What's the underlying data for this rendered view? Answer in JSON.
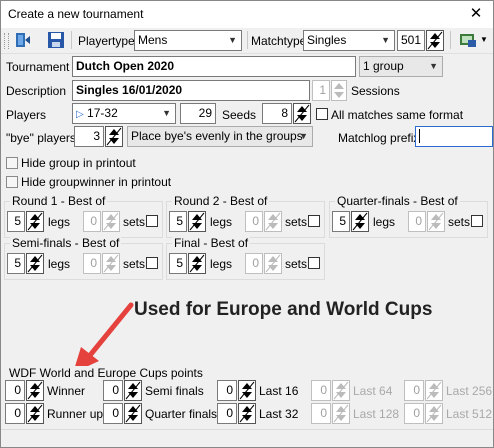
{
  "window": {
    "title": "Create a new tournament",
    "close_glyph": "✕"
  },
  "toolbar": {
    "playertype_label": "Playertype",
    "playertype_value": "Mens",
    "matchtype_label": "Matchtype",
    "matchtype_value": "Singles",
    "score_value": "501"
  },
  "form": {
    "tournament_label": "Tournament",
    "tournament_value": "Dutch Open 2020",
    "groups_value": "1 group",
    "description_label": "Description",
    "description_value": "Singles 16/01/2020",
    "sessions_value": "1",
    "sessions_label": "Sessions",
    "players_label": "Players",
    "players_range_value": "17-32",
    "players_count": "29",
    "seeds_label": "Seeds",
    "seeds_value": "8",
    "same_format_label": "All matches same format",
    "bye_label": "\"bye\" players",
    "bye_value": "3",
    "bye_mode_value": "Place bye's evenly in the groups",
    "matchlog_label": "Matchlog prefix",
    "matchlog_value": "",
    "hide_group_label": "Hide group in printout",
    "hide_groupwinner_label": "Hide groupwinner in printout"
  },
  "rounds": [
    {
      "title": "Round 1 - Best of",
      "legs": "5",
      "sets": "0"
    },
    {
      "title": "Round 2 - Best of",
      "legs": "5",
      "sets": "0"
    },
    {
      "title": "Quarter-finals - Best of",
      "legs": "5",
      "sets": "0"
    },
    {
      "title": "Semi-finals - Best of",
      "legs": "5",
      "sets": "0"
    },
    {
      "title": "Final - Best of",
      "legs": "5",
      "sets": "0"
    }
  ],
  "round_labels": {
    "legs": "legs",
    "sets": "sets"
  },
  "annotation": "Used for Europe and World Cups",
  "points": {
    "title": "WDF World and Europe Cups points",
    "items": [
      {
        "label": "Winner",
        "value": "0",
        "enabled": true
      },
      {
        "label": "Runner up",
        "value": "0",
        "enabled": true
      },
      {
        "label": "Semi finals",
        "value": "0",
        "enabled": true
      },
      {
        "label": "Quarter finals",
        "value": "0",
        "enabled": true
      },
      {
        "label": "Last 16",
        "value": "0",
        "enabled": true
      },
      {
        "label": "Last 32",
        "value": "0",
        "enabled": true
      },
      {
        "label": "Last 64",
        "value": "0",
        "enabled": false
      },
      {
        "label": "Last 128",
        "value": "0",
        "enabled": false
      },
      {
        "label": "Last 256",
        "value": "0",
        "enabled": false
      },
      {
        "label": "Last 512",
        "value": "0",
        "enabled": false
      }
    ]
  },
  "colors": {
    "arrow": "#e5413d",
    "tournament_text": "#000000"
  }
}
